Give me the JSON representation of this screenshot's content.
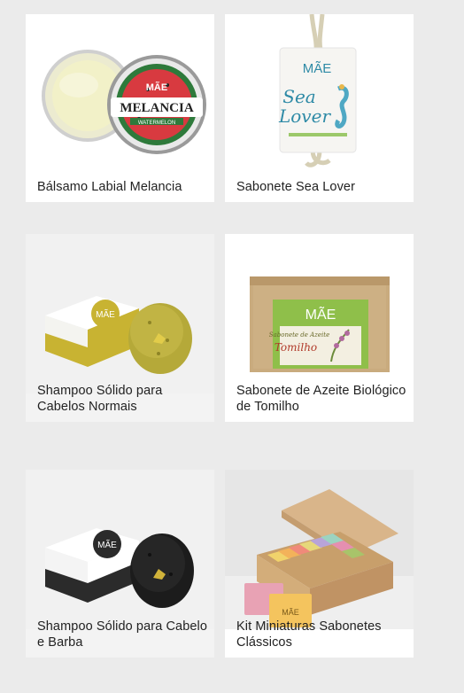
{
  "products": [
    {
      "name": "Bálsamo Labial Melancia",
      "image_alt": "Lip balm tin watermelon"
    },
    {
      "name": "Sabonete Sea Lover",
      "image_alt": "Sea Lover soap on rope"
    },
    {
      "name": "Shampoo Sólido para Cabelos Normais",
      "image_alt": "Yellow solid shampoo bar"
    },
    {
      "name": "Sabonete de Azeite Biológico de Tomilho",
      "image_alt": "Thyme olive oil soap box"
    },
    {
      "name": "Shampoo Sólido para Cabelo e Barba",
      "image_alt": "Black solid shampoo bar"
    },
    {
      "name": "Kit Miniaturas Sabonetes Clássicos",
      "image_alt": "Box of mini soaps"
    }
  ],
  "brand": {
    "logo_text": "MÃE",
    "balm_label": "MELANCIA",
    "balm_sub": "WATERMELON",
    "sea_lover_line1": "Sea",
    "sea_lover_line2": "Lover",
    "thyme_label": "Tomilho",
    "thyme_sub": "Sabonete de Azeite"
  },
  "colors": {
    "page_bg": "#ebebeb",
    "card_bg": "#ffffff",
    "title_text": "#222222"
  }
}
